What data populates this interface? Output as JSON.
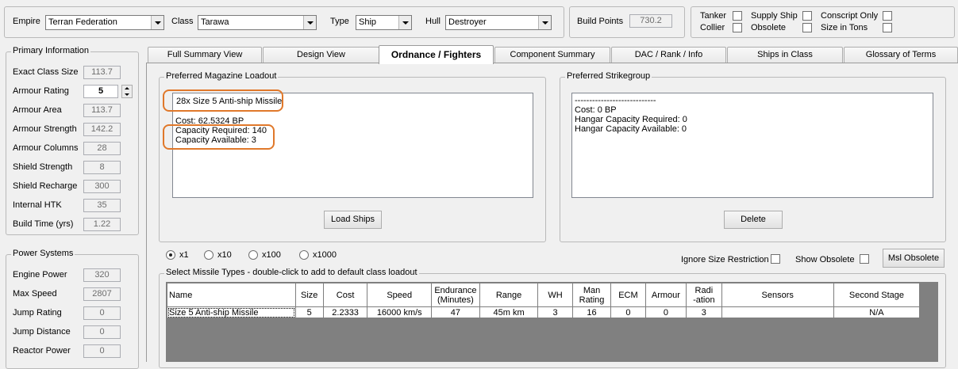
{
  "top": {
    "empire": {
      "label": "Empire",
      "value": "Terran Federation"
    },
    "class": {
      "label": "Class",
      "value": "Tarawa"
    },
    "type": {
      "label": "Type",
      "value": "Ship"
    },
    "hull": {
      "label": "Hull",
      "value": "Destroyer"
    },
    "build_points": {
      "label": "Build Points",
      "value": "730.2"
    },
    "flags": [
      {
        "label": "Tanker"
      },
      {
        "label": "Supply Ship"
      },
      {
        "label": "Conscript Only"
      },
      {
        "label": "Collier"
      },
      {
        "label": "Obsolete"
      },
      {
        "label": "Size in Tons"
      }
    ]
  },
  "primary": {
    "title": "Primary Information",
    "rows": [
      {
        "label": "Exact Class Size",
        "value": "113.7"
      },
      {
        "label": "Armour Rating",
        "value": "5"
      },
      {
        "label": "Armour Area",
        "value": "113.7"
      },
      {
        "label": "Armour Strength",
        "value": "142.2"
      },
      {
        "label": "Armour Columns",
        "value": "28"
      },
      {
        "label": "Shield Strength",
        "value": "8"
      },
      {
        "label": "Shield Recharge",
        "value": "300"
      },
      {
        "label": "Internal HTK",
        "value": "35"
      },
      {
        "label": "Build Time (yrs)",
        "value": "1.22"
      }
    ]
  },
  "power": {
    "title": "Power Systems",
    "rows": [
      {
        "label": "Engine Power",
        "value": "320"
      },
      {
        "label": "Max Speed",
        "value": "2807"
      },
      {
        "label": "Jump Rating",
        "value": "0"
      },
      {
        "label": "Jump Distance",
        "value": "0"
      },
      {
        "label": "Reactor Power",
        "value": "0"
      }
    ]
  },
  "tabs": [
    {
      "label": "Full Summary View"
    },
    {
      "label": "Design View"
    },
    {
      "label": "Ordnance / Fighters"
    },
    {
      "label": "Component Summary"
    },
    {
      "label": "DAC / Rank / Info"
    },
    {
      "label": "Ships in Class"
    },
    {
      "label": "Glossary of Terms"
    }
  ],
  "magazine": {
    "title": "Preferred Magazine Loadout",
    "line1": "28x Size 5 Anti-ship Missile",
    "cost": "Cost: 62.5324 BP",
    "cap_req": "Capacity Required: 140",
    "cap_avail": "Capacity Available: 3",
    "button": "Load Ships"
  },
  "strike": {
    "title": "Preferred Strikegroup",
    "dashes": "----------------------------",
    "cost": "Cost: 0 BP",
    "hangar_req": "Hangar Capacity Required: 0",
    "hangar_avail": "Hangar Capacity Available: 0",
    "button": "Delete"
  },
  "multipliers": [
    {
      "label": "x1",
      "selected": true
    },
    {
      "label": "x10",
      "selected": false
    },
    {
      "label": "x100",
      "selected": false
    },
    {
      "label": "x1000",
      "selected": false
    }
  ],
  "options": {
    "ignore_size": "Ignore Size Restriction",
    "show_obsolete": "Show Obsolete",
    "msl_obsolete": "Msl Obsolete"
  },
  "missiles": {
    "title": "Select Missile Types - double-click to add to default class loadout",
    "headers": [
      "Name",
      "Size",
      "Cost",
      "Speed",
      "Endurance\n(Minutes)",
      "Range",
      "WH",
      "Man\nRating",
      "ECM",
      "Armour",
      "Radi\n-ation",
      "Sensors",
      "Second Stage"
    ],
    "rows": [
      [
        "Size 5 Anti-ship Missile",
        "5",
        "2.2333",
        "16000 km/s",
        "47",
        "45m km",
        "3",
        "16",
        "0",
        "0",
        "3",
        "",
        "N/A"
      ]
    ]
  },
  "colors": {
    "highlight": "#e0782a",
    "grid_bg": "#808080"
  }
}
